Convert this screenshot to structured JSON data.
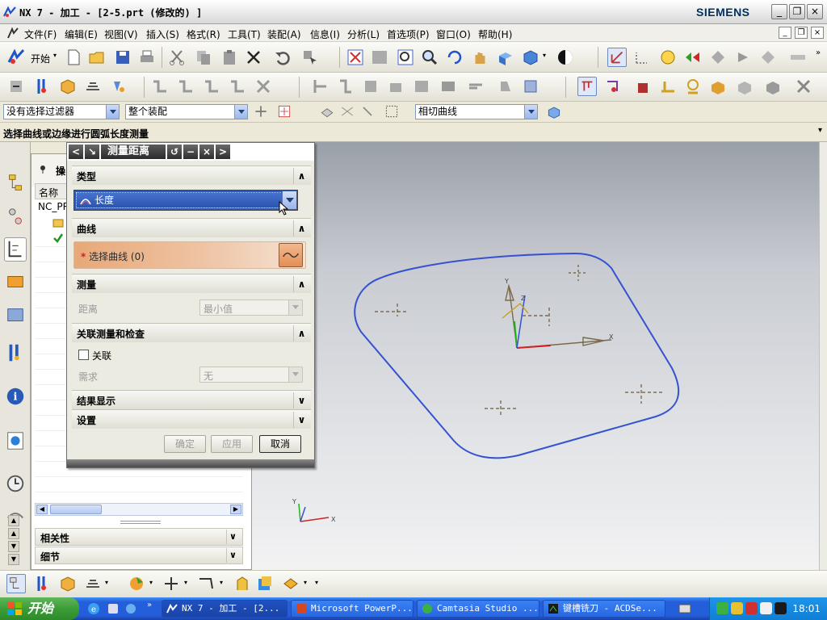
{
  "window": {
    "title": "NX 7 - 加工 - [2-5.prt (修改的) ]",
    "brand": "SIEMENS",
    "controls": [
      "_",
      "❐",
      "×"
    ]
  },
  "menu": {
    "items": [
      "文件(F)",
      "编辑(E)",
      "视图(V)",
      "插入(S)",
      "格式(R)",
      "工具(T)",
      "装配(A)",
      "信息(I)",
      "分析(L)",
      "首选项(P)",
      "窗口(O)",
      "帮助(H)"
    ],
    "mdi_controls": [
      "_",
      "❐",
      "×"
    ]
  },
  "toolbar": {
    "start_label": "开始"
  },
  "filterbar": {
    "selection_filter": "没有选择过滤器",
    "scope": "整个装配",
    "curve_rule": "相切曲线"
  },
  "cue": "选择曲线或边缘进行圆弧长度测量",
  "navigator": {
    "title": "操",
    "column_name": "名称",
    "rows": [
      "NC_PR",
      "",
      ""
    ]
  },
  "nav_sections": {
    "dependencies": "相关性",
    "details": "细节"
  },
  "dialog": {
    "title": "测量距离",
    "groups": {
      "type": "类型",
      "curve": "曲线",
      "measure": "测量",
      "assoc": "关联测量和检查",
      "results": "结果显示",
      "settings": "设置"
    },
    "type_value": "长度",
    "select_curve": "选择曲线 (0)",
    "distance_label": "距离",
    "distance_value": "最小值",
    "associative_label": "关联",
    "requirement_label": "需求",
    "requirement_value": "无",
    "buttons": {
      "ok": "确定",
      "apply": "应用",
      "cancel": "取消"
    }
  },
  "taskbar": {
    "start": "开始",
    "tasks": [
      "NX 7 - 加工 - [2...",
      "Microsoft PowerP...",
      "Camtasia Studio ...",
      "键槽铣刀 - ACDSe..."
    ],
    "clock": "18:01"
  },
  "graphics": {
    "axis_labels": {
      "x": "X",
      "y": "Y",
      "z": "Z"
    }
  },
  "colors": {
    "accent": "#2f5bb7",
    "selection_orange": "#e8a878",
    "curve_blue": "#3552d0",
    "taskbar_blue": "#245edb",
    "start_green": "#3c9c37"
  }
}
